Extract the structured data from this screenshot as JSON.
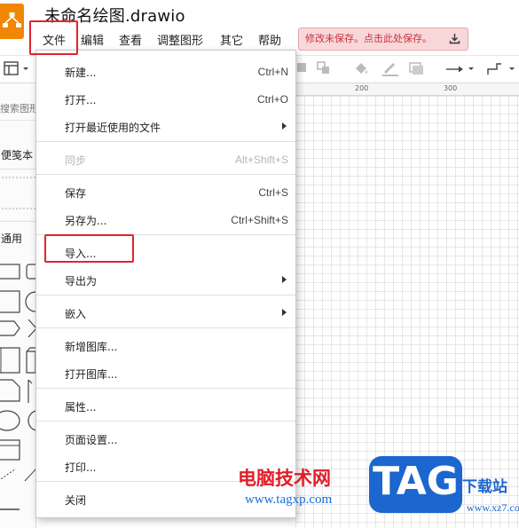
{
  "window": {
    "title": "未命名绘图.drawio"
  },
  "menubar": {
    "items": [
      "文件",
      "编辑",
      "查看",
      "调整图形",
      "其它",
      "帮助"
    ]
  },
  "unsaved_banner": "修改未保存。点击此处保存。",
  "sidebar": {
    "search_placeholder": "搜索图形",
    "scratchpad": "便笺本",
    "general": "通用"
  },
  "ruler": {
    "ticks": [
      "200",
      "300"
    ]
  },
  "file_menu": {
    "items": [
      {
        "label": "新建...",
        "shortcut": "Ctrl+N"
      },
      {
        "label": "打开...",
        "shortcut": "Ctrl+O"
      },
      {
        "label": "打开最近使用的文件",
        "shortcut": ""
      },
      {
        "label": "同步",
        "shortcut": "Alt+Shift+S"
      },
      {
        "label": "保存",
        "shortcut": "Ctrl+S"
      },
      {
        "label": "另存为...",
        "shortcut": "Ctrl+Shift+S"
      },
      {
        "label": "导入...",
        "shortcut": ""
      },
      {
        "label": "导出为",
        "shortcut": ""
      },
      {
        "label": "嵌入",
        "shortcut": ""
      },
      {
        "label": "新增图库...",
        "shortcut": ""
      },
      {
        "label": "打开图库...",
        "shortcut": ""
      },
      {
        "label": "属性...",
        "shortcut": ""
      },
      {
        "label": "页面设置...",
        "shortcut": ""
      },
      {
        "label": "打印...",
        "shortcut": ""
      },
      {
        "label": "关闭",
        "shortcut": ""
      }
    ]
  },
  "watermark": {
    "text": "电脑技术网",
    "url": "www.tagxp.com",
    "tag": "TAG",
    "download": "下载站",
    "site": "www.xz7.com"
  },
  "colors": {
    "accent_orange": "#f08705",
    "highlight_red": "#e0242f",
    "banner_bg": "#f8d7d9",
    "banner_text": "#c8323c",
    "watermark_blue": "#1b66cf",
    "watermark_red": "#e11d2a"
  }
}
